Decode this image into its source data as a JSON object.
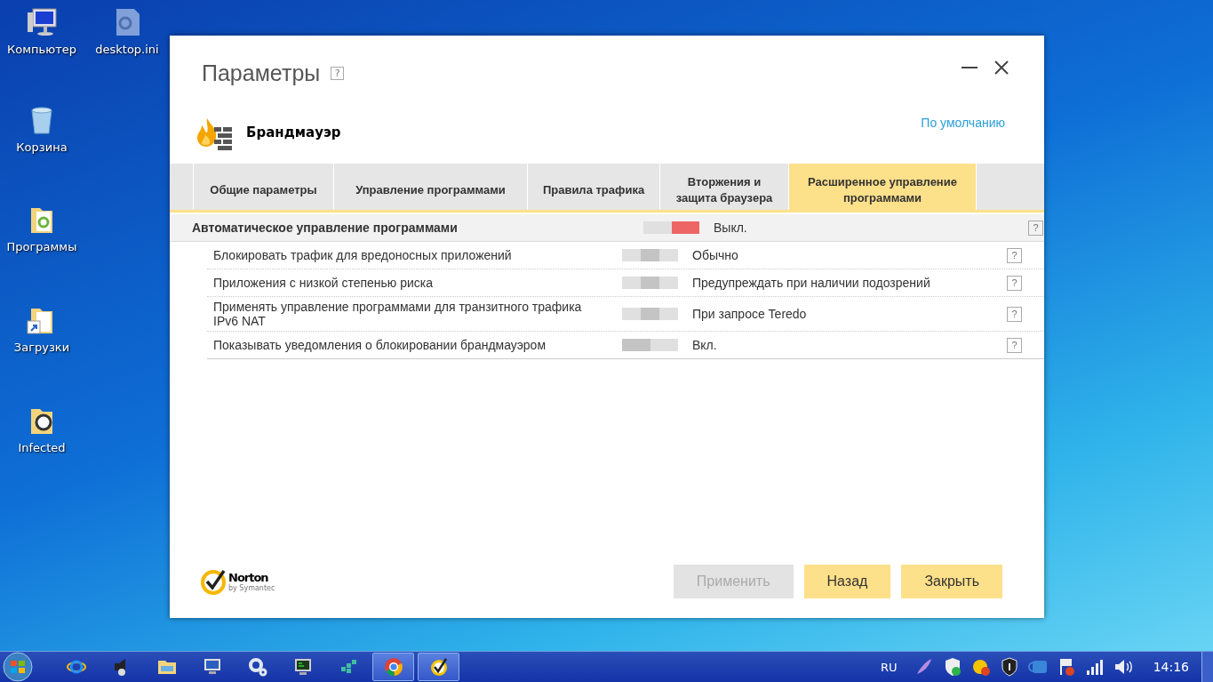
{
  "desktop_icons": [
    {
      "label": "Компьютер",
      "kind": "computer"
    },
    {
      "label": "desktop.ini",
      "kind": "file"
    },
    {
      "label": "Корзина",
      "kind": "bin"
    },
    {
      "label": "Программы",
      "kind": "folder"
    },
    {
      "label": "Загрузки",
      "kind": "shortcut"
    },
    {
      "label": "Infected",
      "kind": "folder_b"
    }
  ],
  "window": {
    "title": "Параметры",
    "help": "?",
    "section": "Брандмауэр",
    "defaults_link": "По умолчанию"
  },
  "tabs": [
    {
      "label": "Общие параметры",
      "selected": false
    },
    {
      "label": "Управление программами",
      "selected": false
    },
    {
      "label": "Правила трафика",
      "selected": false
    },
    {
      "label": "Вторжения и защита браузера",
      "selected": false
    },
    {
      "label": "Расширенное управление программами",
      "selected": true
    }
  ],
  "settings": [
    {
      "label": "Автоматическое управление программами",
      "kind": "header",
      "alert": true,
      "segments": [
        {
          "selected": false
        },
        {
          "selected": true
        }
      ],
      "value": "Выкл.",
      "help": "?"
    },
    {
      "label": "Блокировать трафик для вредоносных приложений",
      "kind": "item",
      "alert": false,
      "segments": [
        {
          "selected": false
        },
        {
          "selected": true
        },
        {
          "selected": false
        }
      ],
      "value": "Обычно",
      "help": "?"
    },
    {
      "label": "Приложения с низкой степенью риска",
      "kind": "item",
      "alert": false,
      "segments": [
        {
          "selected": false
        },
        {
          "selected": true
        },
        {
          "selected": false
        }
      ],
      "value": "Предупреждать при наличии подозрений",
      "help": "?"
    },
    {
      "label": "Применять управление программами для транзитного трафика IPv6 NAT",
      "kind": "item",
      "alert": false,
      "segments": [
        {
          "selected": false
        },
        {
          "selected": true
        },
        {
          "selected": false
        }
      ],
      "value": "При запросе Teredo",
      "help": "?"
    },
    {
      "label": "Показывать уведомления о блокировании брандмауэром",
      "kind": "item",
      "alert": false,
      "segments": [
        {
          "selected": true
        },
        {
          "selected": false
        }
      ],
      "value": "Вкл.",
      "help": "?"
    }
  ],
  "logo": {
    "name": "Norton",
    "sub": "by Symantec"
  },
  "buttons": [
    {
      "label": "Применить",
      "disabled": true
    },
    {
      "label": "Назад",
      "disabled": false
    },
    {
      "label": "Закрыть",
      "disabled": false
    }
  ],
  "taskbar": {
    "apps": [
      {
        "kind": "ie",
        "open": false
      },
      {
        "kind": "speaker",
        "open": false
      },
      {
        "kind": "explorer",
        "open": false
      },
      {
        "kind": "monitor",
        "open": false
      },
      {
        "kind": "gears",
        "open": false
      },
      {
        "kind": "terminal",
        "open": false
      },
      {
        "kind": "cubes",
        "open": false
      },
      {
        "kind": "chrome",
        "open": true
      },
      {
        "kind": "norton",
        "open": true
      }
    ],
    "language": "RU",
    "time": "14:16"
  }
}
